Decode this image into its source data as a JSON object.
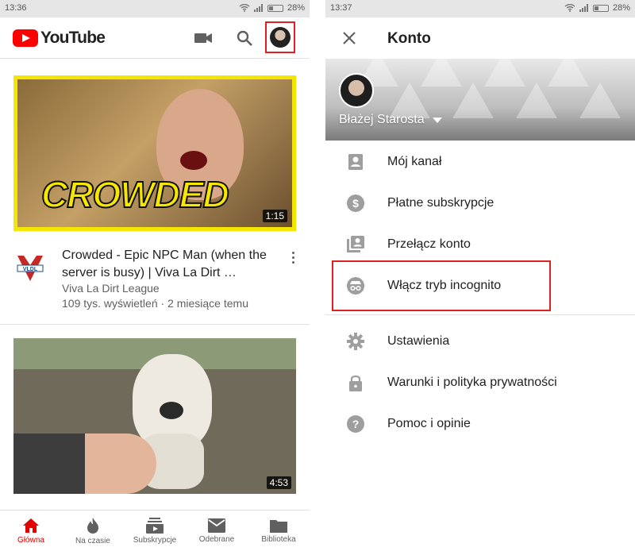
{
  "left": {
    "status": {
      "time": "13:36",
      "battery": "28%"
    },
    "header": {
      "logo_text": "YouTube"
    },
    "video1": {
      "thumb_text": "CROWDED",
      "duration": "1:15",
      "title": "Crowded - Epic NPC Man (when the server is busy) | Viva La Dirt …",
      "channel": "Viva La Dirt League",
      "meta": "109 tys. wyświetleń · 2 miesiące temu",
      "channel_logo_text": "VLDL"
    },
    "video2": {
      "duration": "4:53"
    },
    "nav": [
      {
        "label": "Główna",
        "icon": "home-icon",
        "active": true
      },
      {
        "label": "Na czasie",
        "icon": "flame-icon"
      },
      {
        "label": "Subskrypcje",
        "icon": "subscriptions-icon"
      },
      {
        "label": "Odebrane",
        "icon": "mail-icon"
      },
      {
        "label": "Biblioteka",
        "icon": "folder-icon"
      }
    ]
  },
  "right": {
    "status": {
      "time": "13:37",
      "battery": "28%"
    },
    "title": "Konto",
    "user_name": "Błażej Starosta",
    "menu": [
      {
        "label": "Mój kanał",
        "icon": "person-icon"
      },
      {
        "label": "Płatne subskrypcje",
        "icon": "dollar-icon"
      },
      {
        "label": "Przełącz konto",
        "icon": "switch-account-icon"
      },
      {
        "label": "Włącz tryb incognito",
        "icon": "incognito-icon"
      },
      {
        "label": "Ustawienia",
        "icon": "gear-icon"
      },
      {
        "label": "Warunki i polityka prywatności",
        "icon": "lock-icon"
      },
      {
        "label": "Pomoc i opinie",
        "icon": "help-icon"
      }
    ]
  },
  "colors": {
    "brand_red": "#ff0000",
    "highlight_red": "#e02020",
    "icon_gray": "#9e9e9e"
  }
}
